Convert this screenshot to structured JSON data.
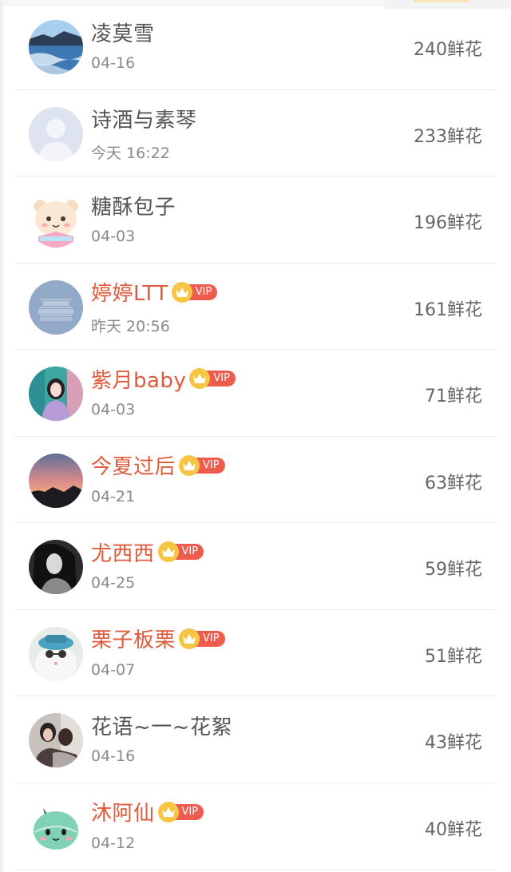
{
  "rows": [
    {
      "name": "凌莫雪",
      "vip": false,
      "date": "04-16",
      "flowers": "240鲜花",
      "avatar_icon": "seascape-photo-avatar"
    },
    {
      "name": "诗酒与素琴",
      "vip": false,
      "date": "今天 16:22",
      "flowers": "233鲜花",
      "avatar_icon": "default-person-avatar"
    },
    {
      "name": "糖酥包子",
      "vip": false,
      "date": "04-03",
      "flowers": "196鲜花",
      "avatar_icon": "cartoon-hamster-avatar"
    },
    {
      "name": "婷婷LTT",
      "vip": true,
      "date": "昨天 20:56",
      "flowers": "161鲜花",
      "avatar_icon": "text-logo-avatar"
    },
    {
      "name": "紫月baby",
      "vip": true,
      "date": "04-03",
      "flowers": "71鲜花",
      "avatar_icon": "girl-photo-avatar"
    },
    {
      "name": "今夏过后",
      "vip": true,
      "date": "04-21",
      "flowers": "63鲜花",
      "avatar_icon": "sunset-photo-avatar"
    },
    {
      "name": "尤西西",
      "vip": true,
      "date": "04-25",
      "flowers": "59鲜花",
      "avatar_icon": "bw-portrait-avatar"
    },
    {
      "name": "栗子板栗",
      "vip": true,
      "date": "04-07",
      "flowers": "51鲜花",
      "avatar_icon": "cat-with-hat-avatar"
    },
    {
      "name": "花语~一~花絮",
      "vip": false,
      "date": "04-16",
      "flowers": "43鲜花",
      "avatar_icon": "couple-photo-avatar"
    },
    {
      "name": "沐阿仙",
      "vip": true,
      "date": "04-12",
      "flowers": "40鲜花",
      "avatar_icon": "green-dino-avatar"
    }
  ],
  "vip_badge_label": "VIP",
  "colors": {
    "vip_name": "#e05a3c",
    "normal_name": "#555555",
    "badge_red": "#ee5c4e",
    "crown_gold": "#f6c544"
  }
}
